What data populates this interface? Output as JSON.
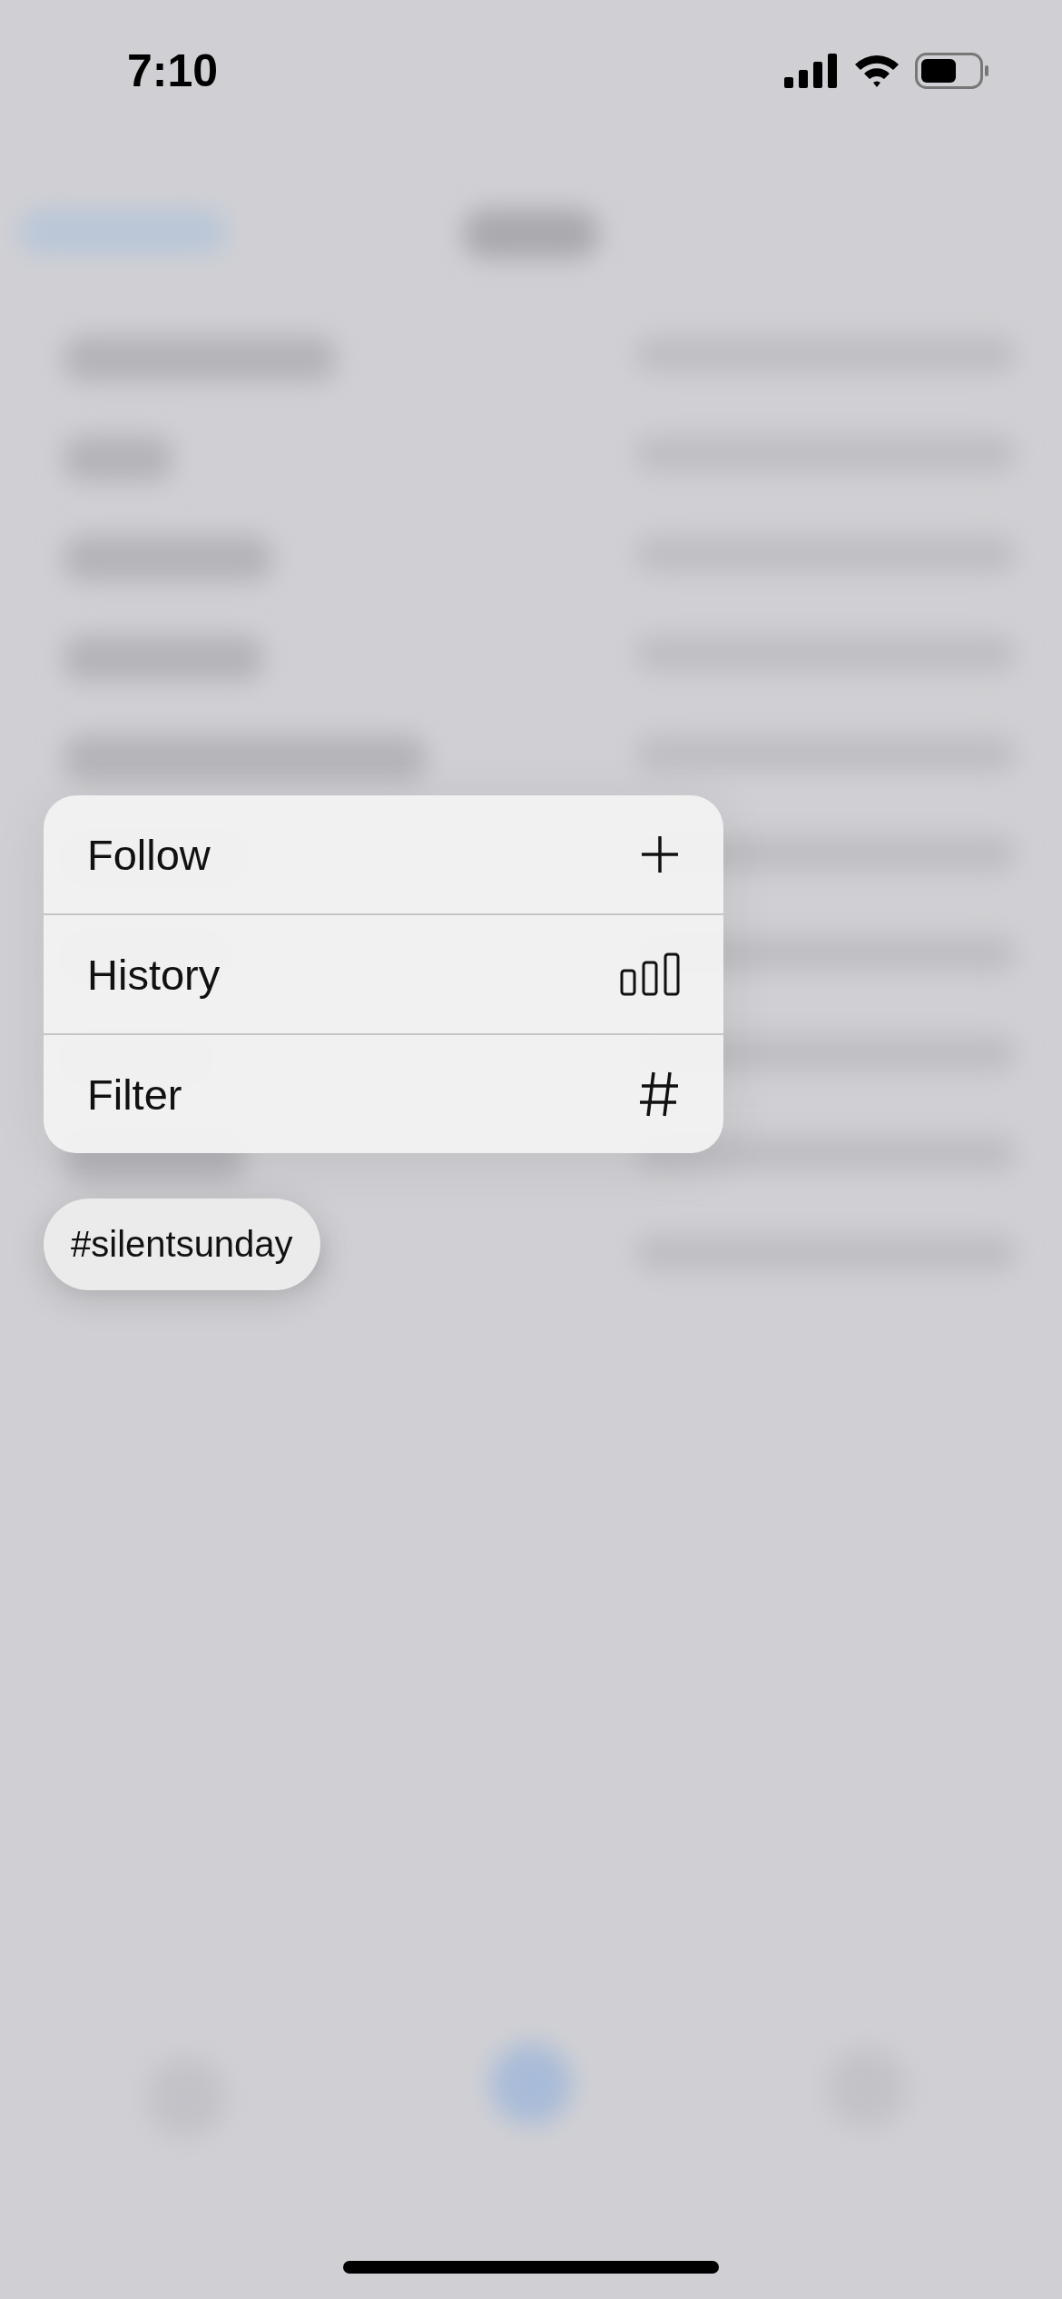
{
  "status_bar": {
    "time": "7:10"
  },
  "menu": {
    "items": [
      {
        "label": "Follow",
        "kind": "plus"
      },
      {
        "label": "History",
        "kind": "bars"
      },
      {
        "label": "Filter",
        "kind": "hash"
      }
    ]
  },
  "hashtag": "#silentsunday"
}
